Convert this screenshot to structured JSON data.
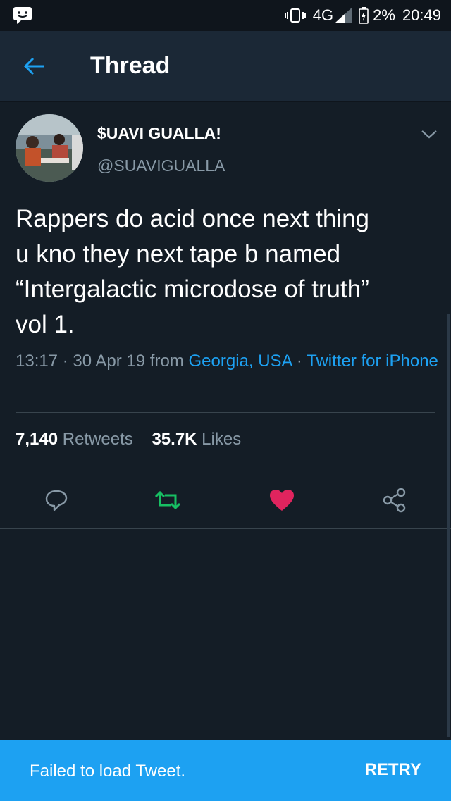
{
  "status_bar": {
    "network": "4G",
    "battery": "2%",
    "time": "20:49"
  },
  "header": {
    "title": "Thread"
  },
  "tweet": {
    "author_name": "$UAVI GUALLA!",
    "author_handle": "@SUAVIGUALLA",
    "text": "Rappers do acid once next thing\nu kno they next tape b named\n“Intergalactic microdose of truth”\nvol 1.",
    "time_date": "13:17 · 30 Apr 19 from ",
    "location": "Georgia, USA",
    "separator": " · ",
    "client": "Twitter for iPhone",
    "retweets_count": "7,140",
    "retweets_label": "Retweets",
    "likes_count": "35.7K",
    "likes_label": "Likes"
  },
  "snackbar": {
    "message": "Failed to load Tweet.",
    "action_label": "RETRY"
  },
  "colors": {
    "background": "#141d26",
    "header": "#1b2836",
    "accent": "#1da1f2",
    "retweet_active": "#17bf63",
    "like_active": "#e0245e",
    "muted_text": "#8899a6"
  }
}
